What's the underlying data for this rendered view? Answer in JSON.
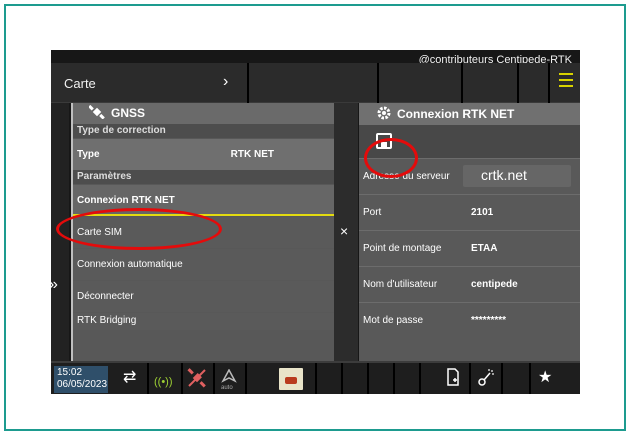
{
  "watermark": "@contributeurs Centipede-RTK",
  "topbar": {
    "title": "Carte",
    "chevron": "›"
  },
  "left_panel": {
    "title": "GNSS",
    "section_correction": "Type de correction",
    "type_label": "Type",
    "type_value": "RTK NET",
    "section_params": "Paramètres",
    "items": [
      "Connexion RTK NET",
      "Carte SIM",
      "Connexion automatique",
      "Déconnecter",
      "RTK Bridging"
    ],
    "expand_arrow": "»"
  },
  "close_symbol": "×",
  "right_panel": {
    "title": "Connexion RTK NET",
    "fields": [
      {
        "label": "Adresse du serveur",
        "value": "crtk.net"
      },
      {
        "label": "Port",
        "value": "2101"
      },
      {
        "label": "Point de montage",
        "value": "ETAA"
      },
      {
        "label": "Nom d'utilisateur",
        "value": "centipede"
      },
      {
        "label": "Mot de passe",
        "value": "*********"
      }
    ]
  },
  "bottombar": {
    "time": "15:02",
    "date": "06/05/2023",
    "auto_label": "auto",
    "star": "★"
  },
  "icons": {
    "satellite": "satellite-icon",
    "gear": "gear-icon",
    "save": "save-icon",
    "menu": "hamburger-menu-icon",
    "swap": "swap-arrows-icon",
    "signal": "radio-signal-icon",
    "satellite_red": "satellite-disabled-icon",
    "steering": "auto-steering-icon",
    "document": "document-add-icon",
    "tool": "sprayer-icon"
  },
  "colors": {
    "highlight": "#e3db10",
    "annotation": "#e40b0b",
    "signal_green": "#9dcf34",
    "frame": "#1d9b8f"
  }
}
